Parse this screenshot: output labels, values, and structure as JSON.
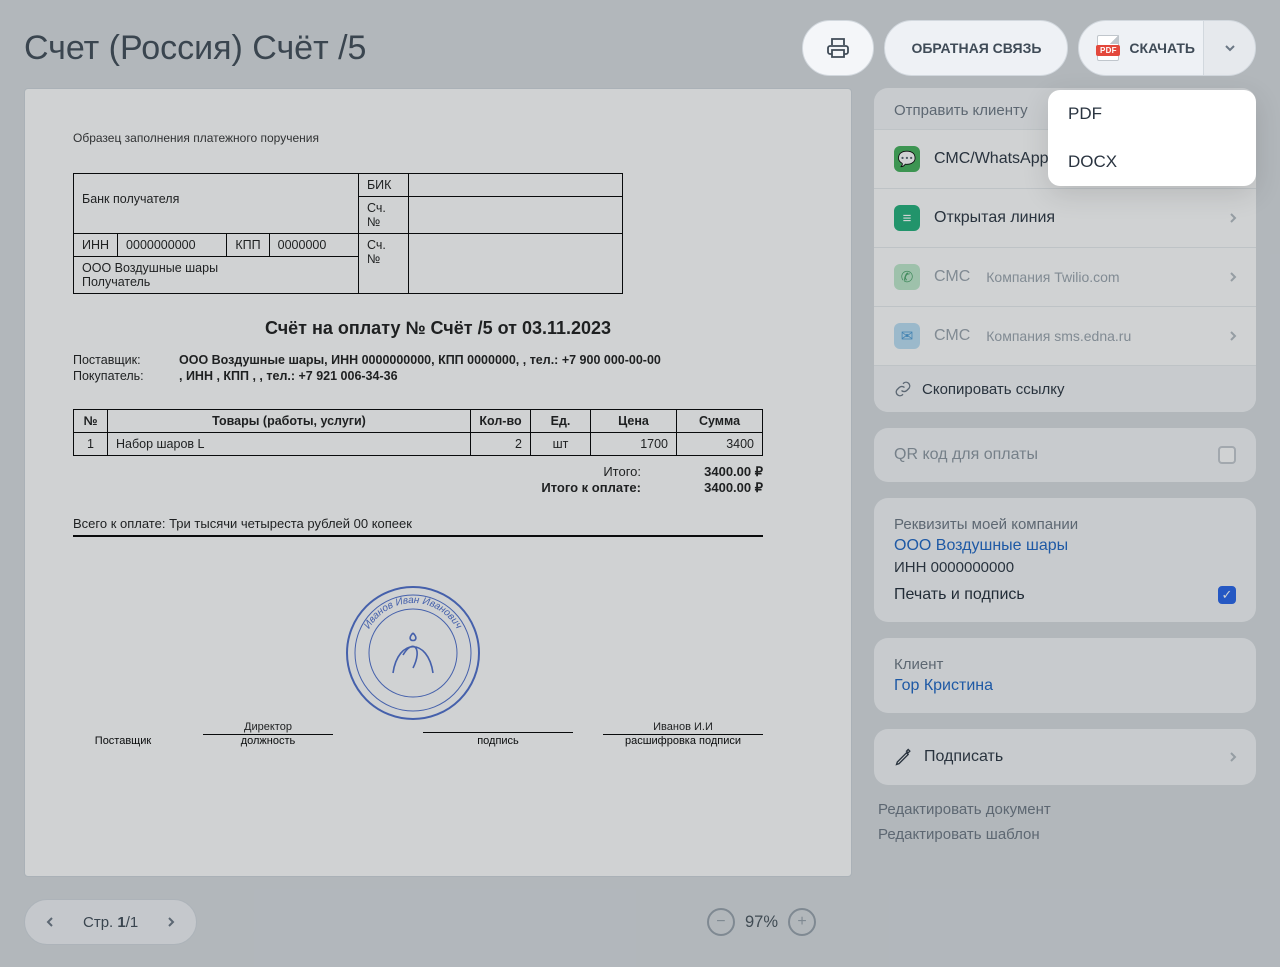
{
  "header": {
    "title": "Счет (Россия) Счёт /5",
    "feedback": "ОБРАТНАЯ СВЯЗЬ",
    "download": "СКАЧАТЬ",
    "dropdown": {
      "pdf": "PDF",
      "docx": "DOCX"
    }
  },
  "document": {
    "hint": "Образец заполнения платежного поручения",
    "bank": {
      "bik_label": "БИК",
      "acc_label": "Сч. №",
      "recipient_bank_label": "Банк получателя",
      "inn_label": "ИНН",
      "inn": "0000000000",
      "kpp_label": "КПП",
      "kpp": "0000000",
      "acc_label2": "Сч. №",
      "recipient_name": "ООО Воздушные шары",
      "recipient_label": "Получатель"
    },
    "title": "Счёт на оплату № Счёт /5 от 03.11.2023",
    "supplier_label": "Поставщик:",
    "supplier_value": "ООО Воздушные шары, ИНН 0000000000, КПП 0000000, , тел.: +7 900 000-00-00",
    "buyer_label": "Покупатель:",
    "buyer_value": ", ИНН , КПП , , тел.: +7 921 006-34-36",
    "items_header": {
      "no": "№",
      "name": "Товары (работы, услуги)",
      "qty": "Кол-во",
      "unit": "Ед.",
      "price": "Цена",
      "sum": "Сумма"
    },
    "items": [
      {
        "no": "1",
        "name": "Набор шаров L",
        "qty": "2",
        "unit": "шт",
        "price": "1700",
        "sum": "3400"
      }
    ],
    "totals": {
      "subtotal_label": "Итого:",
      "subtotal": "3400.00 ₽",
      "total_label": "Итого к оплате:",
      "total": "3400.00 ₽"
    },
    "in_words_label": "Всего к оплате:",
    "in_words": "Три тысячи четыреста рублей 00 копеек",
    "sig": {
      "supplier": "Поставщик",
      "position": "Директор",
      "position_caption": "должность",
      "sign_caption": "подпись",
      "decoded": "Иванов И.И",
      "decoded_caption": "расшифровка подписи",
      "stamp_name": "Иванов Иван Иванович"
    }
  },
  "send": {
    "title": "Отправить клиенту",
    "sms": "СМС/WhatsApp",
    "openline": "Открытая линия",
    "sms_twilio_label": "СМС",
    "sms_twilio_meta": "Компания Twilio.com",
    "sms_edna_label": "СМС",
    "sms_edna_meta": "Компания sms.edna.ru",
    "copy_link": "Скопировать ссылку"
  },
  "qr": {
    "label": "QR код для оплаты"
  },
  "company": {
    "title": "Реквизиты моей компании",
    "name": "ООО Воздушные шары",
    "inn": "ИНН 0000000000",
    "stamp_label": "Печать и подпись"
  },
  "client": {
    "title": "Клиент",
    "name": "Гор Кристина"
  },
  "sign_action": "Подписать",
  "links": {
    "edit_doc": "Редактировать документ",
    "edit_tpl": "Редактировать шаблон"
  },
  "footer": {
    "page_prefix": "Стр. ",
    "page": "1",
    "page_sep": "/",
    "pages": "1",
    "zoom": "97%"
  }
}
